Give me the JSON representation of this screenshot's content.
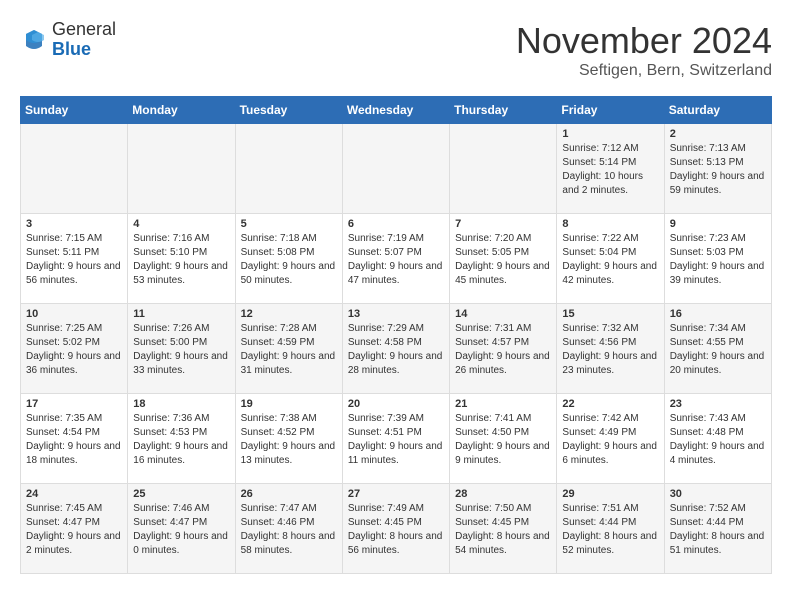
{
  "logo": {
    "general": "General",
    "blue": "Blue"
  },
  "title": "November 2024",
  "subtitle": "Seftigen, Bern, Switzerland",
  "headers": [
    "Sunday",
    "Monday",
    "Tuesday",
    "Wednesday",
    "Thursday",
    "Friday",
    "Saturday"
  ],
  "weeks": [
    [
      {
        "day": "",
        "info": ""
      },
      {
        "day": "",
        "info": ""
      },
      {
        "day": "",
        "info": ""
      },
      {
        "day": "",
        "info": ""
      },
      {
        "day": "",
        "info": ""
      },
      {
        "day": "1",
        "info": "Sunrise: 7:12 AM\nSunset: 5:14 PM\nDaylight: 10 hours and 2 minutes."
      },
      {
        "day": "2",
        "info": "Sunrise: 7:13 AM\nSunset: 5:13 PM\nDaylight: 9 hours and 59 minutes."
      }
    ],
    [
      {
        "day": "3",
        "info": "Sunrise: 7:15 AM\nSunset: 5:11 PM\nDaylight: 9 hours and 56 minutes."
      },
      {
        "day": "4",
        "info": "Sunrise: 7:16 AM\nSunset: 5:10 PM\nDaylight: 9 hours and 53 minutes."
      },
      {
        "day": "5",
        "info": "Sunrise: 7:18 AM\nSunset: 5:08 PM\nDaylight: 9 hours and 50 minutes."
      },
      {
        "day": "6",
        "info": "Sunrise: 7:19 AM\nSunset: 5:07 PM\nDaylight: 9 hours and 47 minutes."
      },
      {
        "day": "7",
        "info": "Sunrise: 7:20 AM\nSunset: 5:05 PM\nDaylight: 9 hours and 45 minutes."
      },
      {
        "day": "8",
        "info": "Sunrise: 7:22 AM\nSunset: 5:04 PM\nDaylight: 9 hours and 42 minutes."
      },
      {
        "day": "9",
        "info": "Sunrise: 7:23 AM\nSunset: 5:03 PM\nDaylight: 9 hours and 39 minutes."
      }
    ],
    [
      {
        "day": "10",
        "info": "Sunrise: 7:25 AM\nSunset: 5:02 PM\nDaylight: 9 hours and 36 minutes."
      },
      {
        "day": "11",
        "info": "Sunrise: 7:26 AM\nSunset: 5:00 PM\nDaylight: 9 hours and 33 minutes."
      },
      {
        "day": "12",
        "info": "Sunrise: 7:28 AM\nSunset: 4:59 PM\nDaylight: 9 hours and 31 minutes."
      },
      {
        "day": "13",
        "info": "Sunrise: 7:29 AM\nSunset: 4:58 PM\nDaylight: 9 hours and 28 minutes."
      },
      {
        "day": "14",
        "info": "Sunrise: 7:31 AM\nSunset: 4:57 PM\nDaylight: 9 hours and 26 minutes."
      },
      {
        "day": "15",
        "info": "Sunrise: 7:32 AM\nSunset: 4:56 PM\nDaylight: 9 hours and 23 minutes."
      },
      {
        "day": "16",
        "info": "Sunrise: 7:34 AM\nSunset: 4:55 PM\nDaylight: 9 hours and 20 minutes."
      }
    ],
    [
      {
        "day": "17",
        "info": "Sunrise: 7:35 AM\nSunset: 4:54 PM\nDaylight: 9 hours and 18 minutes."
      },
      {
        "day": "18",
        "info": "Sunrise: 7:36 AM\nSunset: 4:53 PM\nDaylight: 9 hours and 16 minutes."
      },
      {
        "day": "19",
        "info": "Sunrise: 7:38 AM\nSunset: 4:52 PM\nDaylight: 9 hours and 13 minutes."
      },
      {
        "day": "20",
        "info": "Sunrise: 7:39 AM\nSunset: 4:51 PM\nDaylight: 9 hours and 11 minutes."
      },
      {
        "day": "21",
        "info": "Sunrise: 7:41 AM\nSunset: 4:50 PM\nDaylight: 9 hours and 9 minutes."
      },
      {
        "day": "22",
        "info": "Sunrise: 7:42 AM\nSunset: 4:49 PM\nDaylight: 9 hours and 6 minutes."
      },
      {
        "day": "23",
        "info": "Sunrise: 7:43 AM\nSunset: 4:48 PM\nDaylight: 9 hours and 4 minutes."
      }
    ],
    [
      {
        "day": "24",
        "info": "Sunrise: 7:45 AM\nSunset: 4:47 PM\nDaylight: 9 hours and 2 minutes."
      },
      {
        "day": "25",
        "info": "Sunrise: 7:46 AM\nSunset: 4:47 PM\nDaylight: 9 hours and 0 minutes."
      },
      {
        "day": "26",
        "info": "Sunrise: 7:47 AM\nSunset: 4:46 PM\nDaylight: 8 hours and 58 minutes."
      },
      {
        "day": "27",
        "info": "Sunrise: 7:49 AM\nSunset: 4:45 PM\nDaylight: 8 hours and 56 minutes."
      },
      {
        "day": "28",
        "info": "Sunrise: 7:50 AM\nSunset: 4:45 PM\nDaylight: 8 hours and 54 minutes."
      },
      {
        "day": "29",
        "info": "Sunrise: 7:51 AM\nSunset: 4:44 PM\nDaylight: 8 hours and 52 minutes."
      },
      {
        "day": "30",
        "info": "Sunrise: 7:52 AM\nSunset: 4:44 PM\nDaylight: 8 hours and 51 minutes."
      }
    ]
  ]
}
